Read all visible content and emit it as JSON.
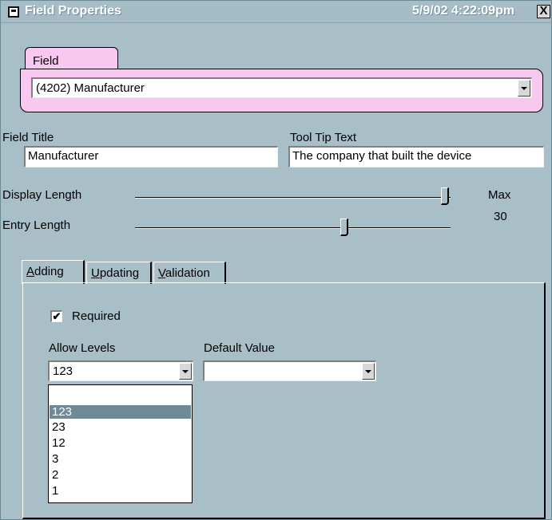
{
  "window": {
    "title": "Field Properties",
    "timestamp": "5/9/02 4:22:09pm",
    "close_label": "X"
  },
  "field": {
    "label": "Field",
    "selected": "(4202) Manufacturer"
  },
  "field_title": {
    "label": "Field Title",
    "value": "Manufacturer"
  },
  "tooltip_text": {
    "label": "Tool Tip Text",
    "value": "The company that built the device"
  },
  "sliders": {
    "display_length_label": "Display Length",
    "entry_length_label": "Entry Length",
    "max_label": "Max",
    "max_value": "30",
    "display_length_level": 1.0,
    "entry_length_level": 0.67
  },
  "tabs": [
    {
      "label": "Adding",
      "mnemonic": "A",
      "rest": "dding",
      "active": true
    },
    {
      "label": "Updating",
      "mnemonic": "U",
      "rest": "pdating",
      "active": false
    },
    {
      "label": "Validation",
      "mnemonic": "V",
      "rest": "alidation",
      "active": false
    }
  ],
  "adding": {
    "required_label": "Required",
    "required_checked": true,
    "allow_levels_label": "Allow Levels",
    "allow_levels_value": "123",
    "default_value_label": "Default Value",
    "default_value": "",
    "allow_levels_options": [
      "",
      "123",
      "23",
      "12",
      "3",
      "2",
      "1"
    ],
    "highlighted_option": "123"
  },
  "colors": {
    "window_bg": "#a8bfc8",
    "field_group_bg": "#f8c8f0",
    "selection_bg": "#6f8a96"
  }
}
